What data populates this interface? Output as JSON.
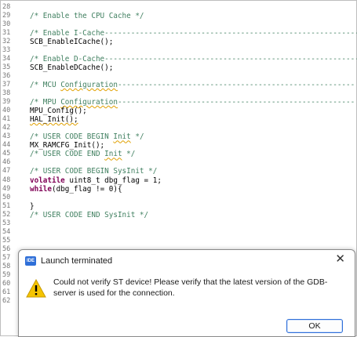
{
  "editor": {
    "lines": [
      {
        "n": "28",
        "segs": []
      },
      {
        "n": "29",
        "segs": [
          {
            "t": "/* Enable the CPU Cache */",
            "c": "cm"
          }
        ]
      },
      {
        "n": "30",
        "segs": []
      },
      {
        "n": "31",
        "segs": [
          {
            "t": "/* Enable I-Cache-----------------------------------------------------------",
            "c": "cm"
          }
        ]
      },
      {
        "n": "32",
        "segs": [
          {
            "t": "SCB_EnableICache();",
            "c": "fn"
          }
        ]
      },
      {
        "n": "33",
        "segs": []
      },
      {
        "n": "34",
        "segs": [
          {
            "t": "/* Enable D-Cache-----------------------------------------------------------",
            "c": "cm"
          }
        ]
      },
      {
        "n": "35",
        "segs": [
          {
            "t": "SCB_EnableDCache();",
            "c": "fn"
          }
        ]
      },
      {
        "n": "36",
        "segs": []
      },
      {
        "n": "37",
        "segs": [
          {
            "t": "/* MCU ",
            "c": "cm"
          },
          {
            "t": "Configuration",
            "c": "cm ul"
          },
          {
            "t": "------------------------------------------------------",
            "c": "cm"
          }
        ]
      },
      {
        "n": "38",
        "segs": []
      },
      {
        "n": "39",
        "segs": [
          {
            "t": "/* MPU ",
            "c": "cm"
          },
          {
            "t": "Configuration",
            "c": "cm ul"
          },
          {
            "t": "------------------------------------------------------",
            "c": "cm"
          }
        ]
      },
      {
        "n": "40",
        "segs": [
          {
            "t": "MPU_Config();",
            "c": "fn"
          }
        ]
      },
      {
        "n": "41",
        "segs": [
          {
            "t": "HAL_Init();",
            "c": "fn ul"
          }
        ]
      },
      {
        "n": "42",
        "segs": []
      },
      {
        "n": "43",
        "segs": [
          {
            "t": "/* USER CODE BEGIN ",
            "c": "cm"
          },
          {
            "t": "Init",
            "c": "cm ul"
          },
          {
            "t": " */",
            "c": "cm"
          }
        ]
      },
      {
        "n": "44",
        "segs": [
          {
            "t": "MX_RAMCFG_Init();",
            "c": "fn"
          }
        ]
      },
      {
        "n": "45",
        "segs": [
          {
            "t": "/* USER CODE END ",
            "c": "cm"
          },
          {
            "t": "Init",
            "c": "cm ul"
          },
          {
            "t": " */",
            "c": "cm"
          }
        ]
      },
      {
        "n": "46",
        "segs": []
      },
      {
        "n": "47",
        "segs": [
          {
            "t": "/* USER CODE BEGIN SysInit */",
            "c": "cm"
          }
        ]
      },
      {
        "n": "48",
        "segs": [
          {
            "t": "volatile",
            "c": "kw"
          },
          {
            "t": " uint8_t dbg_flag = 1;",
            "c": "fn"
          }
        ]
      },
      {
        "n": "49",
        "segs": [
          {
            "t": "while",
            "c": "kw"
          },
          {
            "t": "(dbg_flag != 0){",
            "c": "fn"
          }
        ]
      },
      {
        "n": "50",
        "segs": []
      },
      {
        "n": "51",
        "segs": [
          {
            "t": "}",
            "c": "fn"
          }
        ]
      },
      {
        "n": "52",
        "segs": [
          {
            "t": "/* USER CODE END SysInit */",
            "c": "cm"
          }
        ]
      },
      {
        "n": "53",
        "segs": []
      },
      {
        "n": "54",
        "segs": []
      },
      {
        "n": "55",
        "segs": []
      },
      {
        "n": "56",
        "segs": []
      },
      {
        "n": "57",
        "segs": []
      },
      {
        "n": "58",
        "segs": []
      },
      {
        "n": "59",
        "segs": []
      },
      {
        "n": "60",
        "segs": []
      },
      {
        "n": "61",
        "segs": []
      },
      {
        "n": "62",
        "segs": []
      }
    ]
  },
  "dialog": {
    "icon_text": "IDE",
    "title": "Launch terminated",
    "close_glyph": "✕",
    "message": "Could not verify ST device! Please verify that the latest version of the GDB-server is used for the connection.",
    "ok_label": "OK",
    "icon": "warning-icon",
    "accent": "#2f6fd8",
    "warning_color": "#f5c400"
  }
}
